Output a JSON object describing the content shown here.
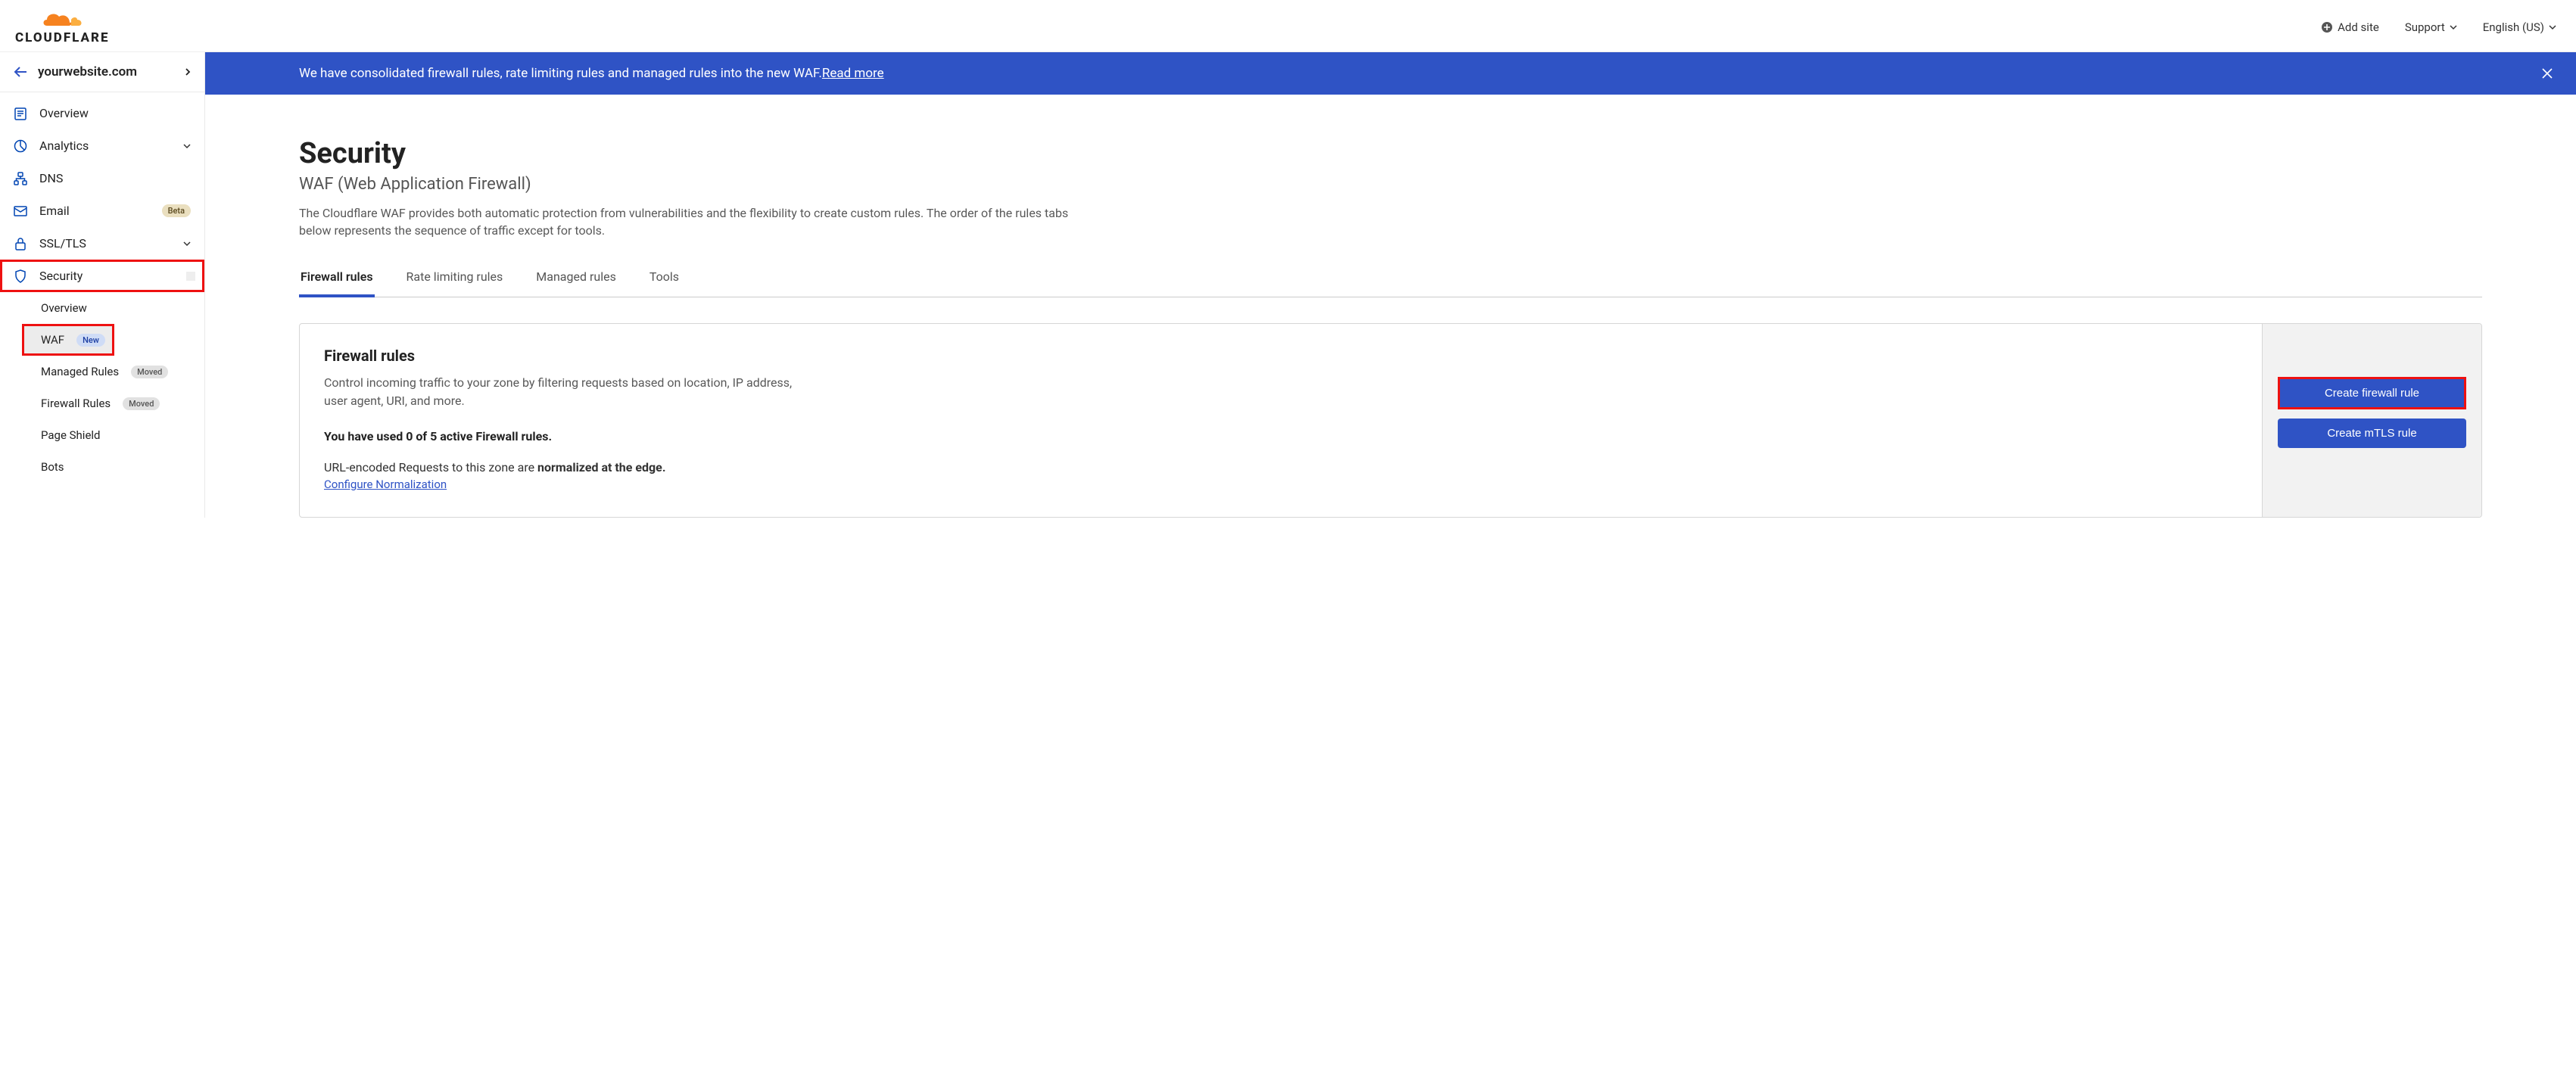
{
  "topbar": {
    "add_site": "Add site",
    "support": "Support",
    "language": "English (US)",
    "logo_text": "CLOUDFLARE"
  },
  "site": {
    "name": "yourwebsite.com"
  },
  "nav": {
    "overview": "Overview",
    "analytics": "Analytics",
    "dns": "DNS",
    "email": "Email",
    "email_badge": "Beta",
    "ssl": "SSL/TLS",
    "security": "Security",
    "sub": {
      "overview": "Overview",
      "waf": "WAF",
      "waf_badge": "New",
      "managed_rules": "Managed Rules",
      "managed_rules_badge": "Moved",
      "firewall_rules": "Firewall Rules",
      "firewall_rules_badge": "Moved",
      "page_shield": "Page Shield",
      "bots": "Bots"
    }
  },
  "banner": {
    "text": "We have consolidated firewall rules, rate limiting rules and managed rules into the new WAF. ",
    "link": "Read more"
  },
  "page": {
    "title": "Security",
    "subtitle": "WAF (Web Application Firewall)",
    "description": "The Cloudflare WAF provides both automatic protection from vulnerabilities and the flexibility to create custom rules. The order of the rules tabs below represents the sequence of traffic except for tools."
  },
  "tabs": {
    "firewall": "Firewall rules",
    "rate": "Rate limiting rules",
    "managed": "Managed rules",
    "tools": "Tools"
  },
  "card": {
    "title": "Firewall rules",
    "text": "Control incoming traffic to your zone by filtering requests based on location, IP address, user agent, URI, and more.",
    "usage": "You have used 0 of 5 active Firewall rules.",
    "norm_prefix": "URL-encoded Requests to this zone are ",
    "norm_bold": "normalized at the edge.",
    "config_link": "Configure Normalization",
    "btn_create": "Create firewall rule",
    "btn_mtls": "Create mTLS rule"
  }
}
